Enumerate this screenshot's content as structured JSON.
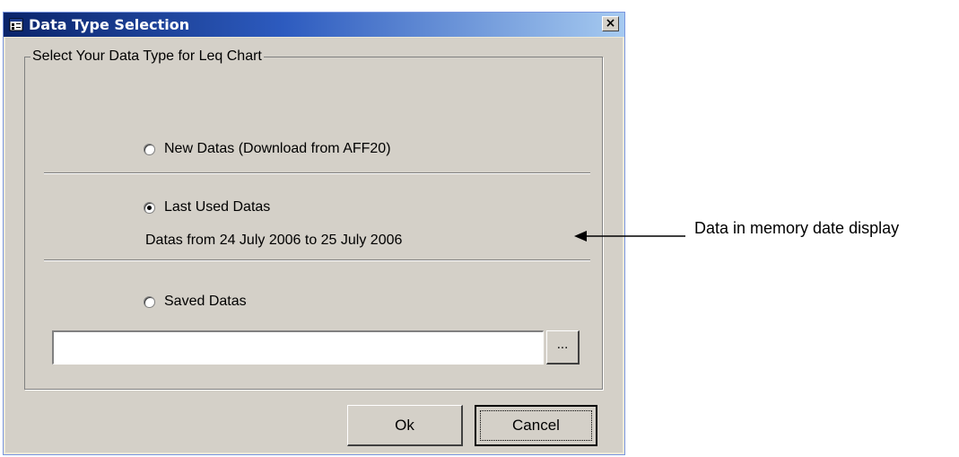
{
  "dialog": {
    "title": "Data Type Selection",
    "close_label": "×",
    "group_title": "Select Your Data Type for Leq Chart",
    "options": [
      {
        "label": "New Datas (Download from AFF20)",
        "checked": false
      },
      {
        "label": "Last Used Datas",
        "checked": true
      },
      {
        "label": "Saved Datas",
        "checked": false
      }
    ],
    "date_range_text": "Datas from 24 July 2006 to 25 July 2006",
    "path_value": "",
    "browse_label": "...",
    "ok_label": "Ok",
    "cancel_label": "Cancel"
  },
  "annotation": {
    "text": "Data in memory date display"
  }
}
